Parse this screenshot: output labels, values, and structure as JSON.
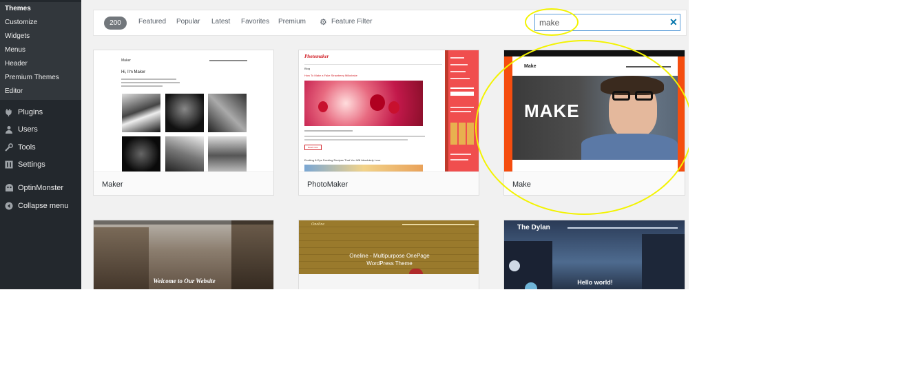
{
  "sidebar": {
    "submenu": [
      "Themes",
      "Customize",
      "Widgets",
      "Menus",
      "Header",
      "Premium Themes",
      "Editor"
    ],
    "menu": [
      {
        "label": "Plugins",
        "icon": "plugin-icon"
      },
      {
        "label": "Users",
        "icon": "users-icon"
      },
      {
        "label": "Tools",
        "icon": "wrench-icon"
      },
      {
        "label": "Settings",
        "icon": "settings-icon"
      },
      {
        "label": "OptinMonster",
        "icon": "optinmonster-icon"
      },
      {
        "label": "Collapse menu",
        "icon": "collapse-icon"
      }
    ]
  },
  "filters": {
    "count": "200",
    "links": [
      "Featured",
      "Popular",
      "Latest",
      "Favorites",
      "Premium"
    ],
    "feature_filter": "Feature Filter"
  },
  "search": {
    "value": "make"
  },
  "themes": [
    {
      "name": "Maker",
      "preview": {
        "site": "Maker",
        "heading": "Hi, I'm Maker"
      }
    },
    {
      "name": "PhotoMaker",
      "preview": {
        "logo": "Photomaker",
        "section": "Blog",
        "post_title": "How To Make a Fake Strawberry Milkshake",
        "read_more": "Read more",
        "post_title_2": "Exciting & Eye Feeding Recipes That You Will Absolutely Love"
      }
    },
    {
      "name": "Make",
      "preview": {
        "site": "Make",
        "hero": "MAKE"
      }
    },
    {
      "name": "",
      "preview": {
        "hero": "Welcome to Our Website"
      }
    },
    {
      "name": "",
      "preview": {
        "logo": "Oneline",
        "hero_1": "Oneline - Multipurpose OnePage",
        "hero_2": "WordPress Theme"
      }
    },
    {
      "name": "",
      "preview": {
        "site": "The Dylan",
        "hero": "Hello world!"
      }
    }
  ],
  "colors": {
    "sidebar_bg": "#23282d",
    "submenu_bg": "#32373c",
    "accent_blue": "#0073aa",
    "annotation": "#f3f300",
    "make_orange": "#f54d0f",
    "photomaker_red": "#f04e4e"
  }
}
